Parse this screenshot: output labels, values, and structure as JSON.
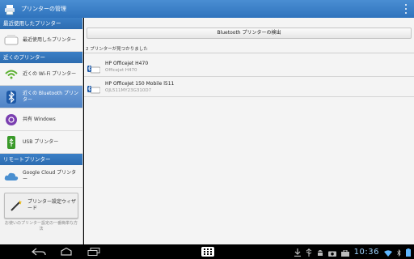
{
  "app": {
    "title": "プリンターの管理"
  },
  "sidebar": {
    "sections": [
      {
        "header": "最近使用したプリンター",
        "items": [
          {
            "label": "最近使用したプリンター"
          }
        ]
      },
      {
        "header": "近くのプリンター",
        "items": [
          {
            "label": "近くの Wi-Fi プリンター"
          },
          {
            "label": "近くの Bluetooth プリンター"
          },
          {
            "label": "共有 Windows"
          },
          {
            "label": "USB プリンター"
          }
        ]
      },
      {
        "header": "リモートプリンター",
        "items": [
          {
            "label": "Google Cloud プリンター"
          }
        ]
      }
    ],
    "wizard": {
      "label": "プリンター設定ウィザード",
      "note": "お使いのプリンター設定の一番簡単な方法"
    }
  },
  "main": {
    "detect_button": "Bluetooth プリンターの検出",
    "found_label": "2 プリンターが見つかりました",
    "printers": [
      {
        "name": "HP Officejet H470",
        "sub": "Officejet H470"
      },
      {
        "name": "HP OfficeJet 150 Mobile l511",
        "sub": "OJL511MY23G310D7"
      }
    ]
  },
  "statusbar": {
    "time": "10:36"
  },
  "colors": {
    "accent": "#3b7fc6",
    "active_item": "#5a8fd0"
  }
}
